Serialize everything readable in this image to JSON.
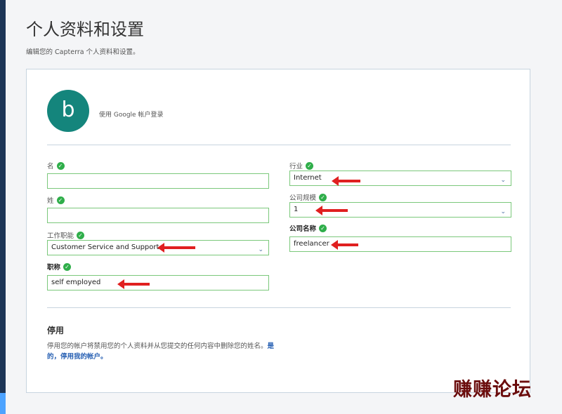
{
  "page": {
    "title": "个人资料和设置",
    "subtitle": "编辑您的 Capterra 个人资料和设置。"
  },
  "profile": {
    "avatar_letter": "b",
    "login_note": "使用 Google 帐户登录"
  },
  "form": {
    "first_name": {
      "label": "名",
      "value": ""
    },
    "last_name": {
      "label": "姓",
      "value": ""
    },
    "job_function": {
      "label": "工作职能",
      "value": "Customer Service and Support"
    },
    "job_title": {
      "label": "职称",
      "value": "self employed"
    },
    "industry": {
      "label": "行业",
      "value": "Internet"
    },
    "company_size": {
      "label": "公司规模",
      "value": "1"
    },
    "company_name": {
      "label": "公司名称",
      "value": "freelancer"
    }
  },
  "deactivate": {
    "title": "停用",
    "text": "停用您的帐户将禁用您的个人资料并从您提交的任何内容中删除您的姓名。",
    "link": "是的，停用我的帐户。"
  },
  "watermark": "赚赚论坛",
  "colors": {
    "valid_border": "#7bc87b",
    "check_green": "#2fae4a",
    "avatar_bg": "#14857c",
    "link_blue": "#2a62b4",
    "annotation_arrow": "#e02020"
  },
  "icons": {
    "check": "check-circle-icon",
    "dropdown": "chevron-down-icon"
  }
}
